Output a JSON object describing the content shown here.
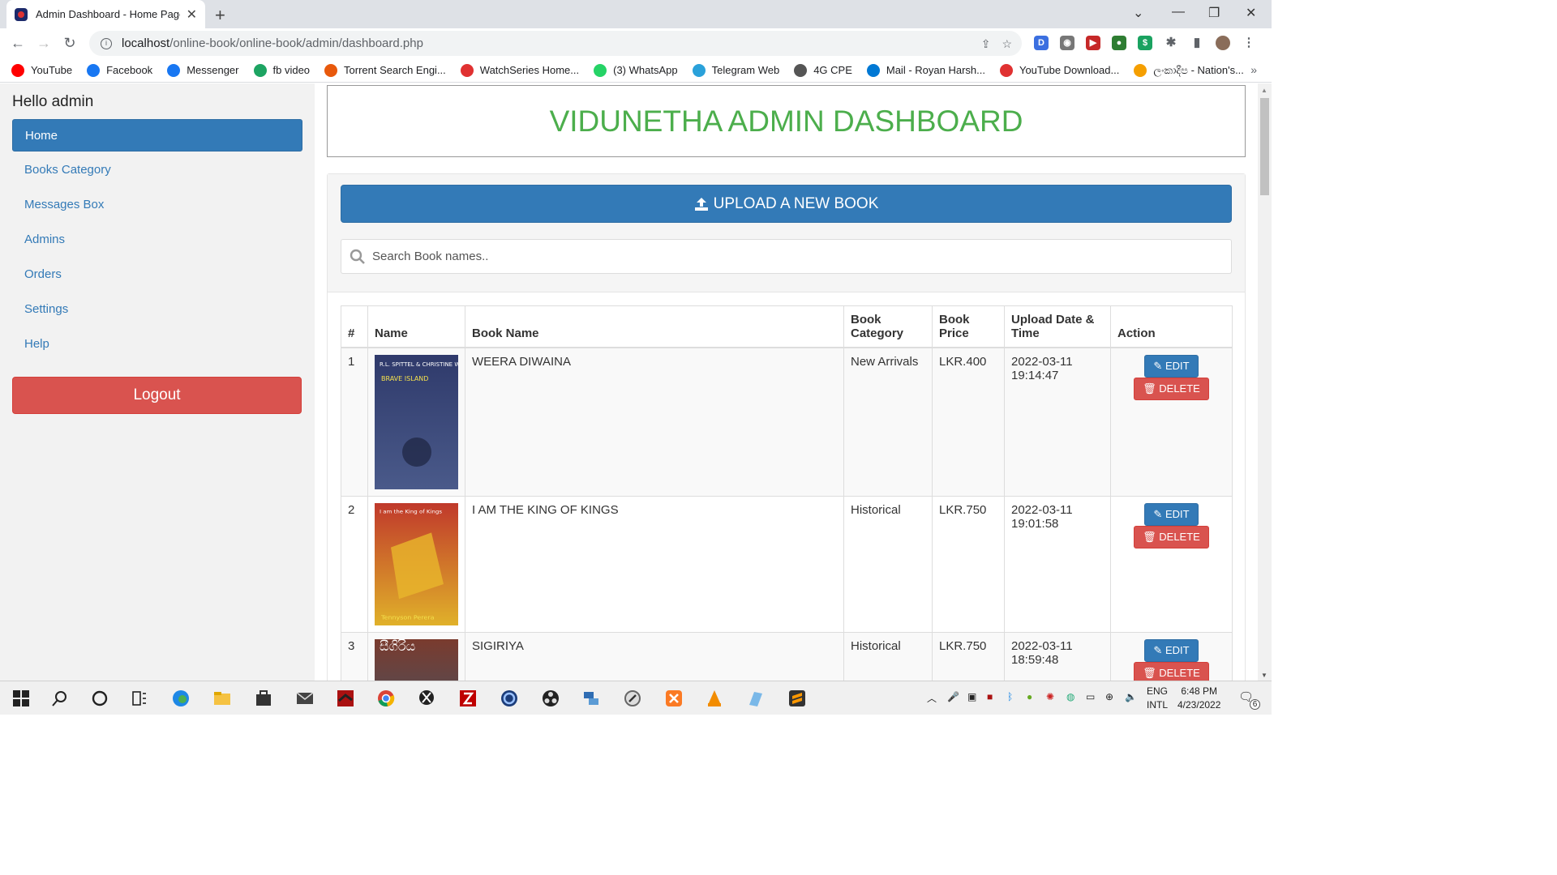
{
  "browser": {
    "tab_title": "Admin Dashboard - Home Page",
    "url_host": "localhost",
    "url_path": "/online-book/online-book/admin/dashboard.php",
    "bookmarks": [
      {
        "label": "YouTube",
        "color": "#ff0000"
      },
      {
        "label": "Facebook",
        "color": "#1877f2"
      },
      {
        "label": "Messenger",
        "color": "#1877f2"
      },
      {
        "label": "fb video",
        "color": "#1da462"
      },
      {
        "label": "Torrent Search Engi...",
        "color": "#e8590c"
      },
      {
        "label": "WatchSeries Home...",
        "color": "#e03131"
      },
      {
        "label": "(3) WhatsApp",
        "color": "#25d366"
      },
      {
        "label": "Telegram Web",
        "color": "#2aa1da"
      },
      {
        "label": "4G CPE",
        "color": "#555555"
      },
      {
        "label": "Mail - Royan Harsh...",
        "color": "#0078d4"
      },
      {
        "label": "YouTube Download...",
        "color": "#e03131"
      },
      {
        "label": "ලංකාදීප - Nation's...",
        "color": "#f59f00"
      }
    ]
  },
  "sidebar": {
    "greeting": "Hello admin",
    "items": [
      {
        "label": "Home",
        "active": true
      },
      {
        "label": "Books Category"
      },
      {
        "label": "Messages Box"
      },
      {
        "label": "Admins"
      },
      {
        "label": "Orders"
      },
      {
        "label": "Settings"
      },
      {
        "label": "Help"
      }
    ],
    "logout_label": "Logout"
  },
  "main": {
    "banner_title": "VIDUNETHA ADMIN DASHBOARD",
    "upload_label": "UPLOAD A NEW BOOK",
    "search_placeholder": "Search Book names..",
    "table": {
      "headers": [
        "#",
        "Name",
        "Book Name",
        "Book Category",
        "Book Price",
        "Upload Date & Time",
        "Action"
      ],
      "rows": [
        {
          "num": "1",
          "book_name": "WEERA DIWAINA",
          "category": "New Arrivals",
          "price": "LKR.400",
          "date": "2022-03-11",
          "time": "19:14:47",
          "cover_text_top": "R.L. SPITTEL & CHRISTINE WILSON",
          "cover_text_mid": "BRAVE ISLAND",
          "cover_colors": [
            "#2f3a6b",
            "#4a5a8a"
          ]
        },
        {
          "num": "2",
          "book_name": "I AM THE KING OF KINGS",
          "category": "Historical",
          "price": "LKR.750",
          "date": "2022-03-11",
          "time": "19:01:58",
          "cover_text_top": "I am the King of Kings",
          "cover_text_mid": "Tennyson Perera",
          "cover_colors": [
            "#c0392b",
            "#e0b12a"
          ]
        },
        {
          "num": "3",
          "book_name": "SIGIRIYA",
          "category": "Historical",
          "price": "LKR.750",
          "date": "2022-03-11",
          "time": "18:59:48",
          "cover_text_top": "සීගිරිය",
          "cover_text_mid": "",
          "cover_colors": [
            "#7a3b2e",
            "#2c5d7a"
          ]
        }
      ],
      "edit_label": "EDIT",
      "delete_label": "DELETE"
    }
  },
  "taskbar": {
    "lang_top": "ENG",
    "lang_bottom": "INTL",
    "time": "6:48 PM",
    "date": "4/23/2022",
    "notification_count": "6"
  }
}
